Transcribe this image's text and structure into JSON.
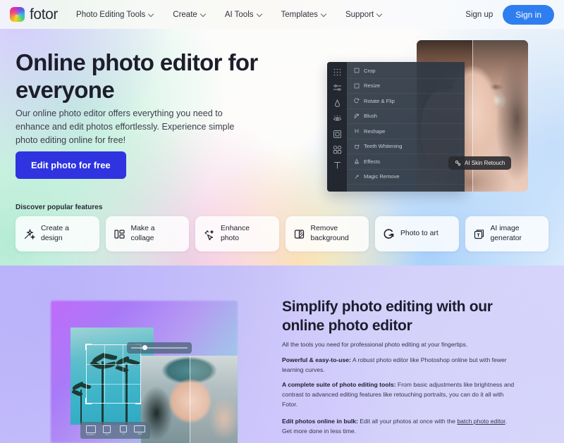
{
  "header": {
    "logo_text": "fotor",
    "nav": [
      {
        "label": "Photo Editing Tools"
      },
      {
        "label": "Create"
      },
      {
        "label": "AI Tools"
      },
      {
        "label": "Templates"
      },
      {
        "label": "Support"
      }
    ],
    "signup_label": "Sign up",
    "signin_label": "Sign in",
    "signin_color": "#2f7ef0"
  },
  "hero": {
    "title": "Online photo editor for everyone",
    "subtitle": "Our online photo editor offers everything you need to enhance and edit photos effortlessly. Experience simple photo editing online for free!",
    "cta_label": "Edit photo for free",
    "cta_color": "#2f34e0",
    "editor": {
      "rail_icons": [
        "grid-icon",
        "sliders-icon",
        "portrait-icon",
        "eye-icon",
        "frame-icon",
        "shapes-icon",
        "text-icon"
      ],
      "menu": [
        {
          "label": "Crop",
          "icon": "crop-icon"
        },
        {
          "label": "Resize",
          "icon": "resize-icon"
        },
        {
          "label": "Rotate & Flip",
          "icon": "rotate-icon"
        },
        {
          "label": "Blush",
          "icon": "blush-icon"
        },
        {
          "label": "Reshape",
          "icon": "reshape-icon"
        },
        {
          "label": "Teeth Whitening",
          "icon": "teeth-icon"
        },
        {
          "label": "Effects",
          "icon": "effects-icon"
        },
        {
          "label": "Magic Remove",
          "icon": "magic-remove-icon"
        }
      ],
      "tooltip_label": "AI Skin Retouch",
      "tooltip_icon": "ai-skin-retouch-icon"
    }
  },
  "features": {
    "label": "Discover popular features",
    "cards": [
      {
        "line1": "Create a",
        "line2": "design",
        "icon": "magic-wand-icon"
      },
      {
        "line1": "Make a",
        "line2": "collage",
        "icon": "collage-grid-icon"
      },
      {
        "line1": "Enhance",
        "line2": "photo",
        "icon": "sparkle-cursor-icon"
      },
      {
        "line1": "Remove",
        "line2": "background",
        "icon": "remove-background-icon"
      },
      {
        "line1": "Photo to art",
        "line2": "",
        "icon": "photo-to-art-icon"
      },
      {
        "line1": "AI image",
        "line2": "generator",
        "icon": "ai-image-generator-icon"
      }
    ]
  },
  "section2": {
    "title": "Simplify photo editing with our online photo editor",
    "lead": "All the tools you need for professional photo editing at your fingertips.",
    "paragraphs": [
      {
        "bold": "Powerful & easy-to-use:",
        "text": " A robust photo editor like Photoshop online but with fewer learning curves."
      },
      {
        "bold": "A complete suite of photo editing tools:",
        "text": " From basic adjustments like brightness and contrast to advanced editing features like retouching portraits, you can do it all with Fotor."
      },
      {
        "bold": "Edit photos online in bulk:",
        "text": " Edit all your photos at once with the ",
        "link": "batch photo editor",
        "text_after": ". Get more done in less time."
      }
    ],
    "ratio_presets": [
      {
        "label": "Freeform"
      },
      {
        "label": "1:1"
      },
      {
        "label": "3:4"
      },
      {
        "label": "16:9"
      }
    ]
  }
}
